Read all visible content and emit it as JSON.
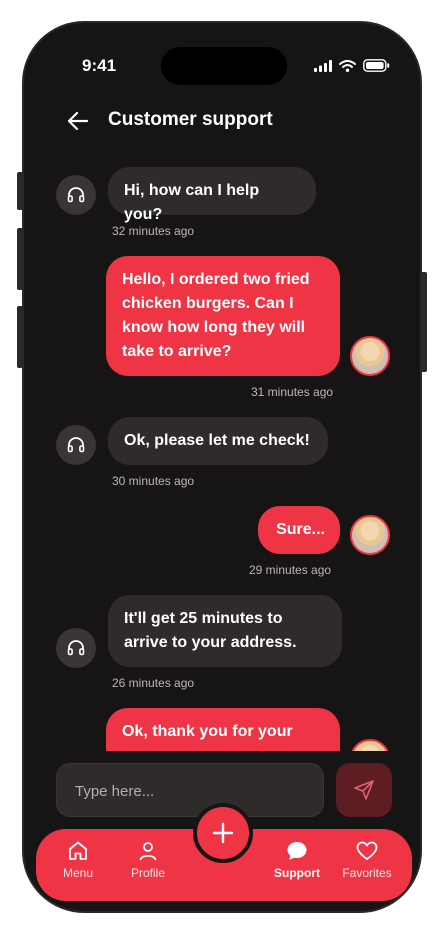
{
  "status_bar": {
    "time": "9:41"
  },
  "header": {
    "title": "Customer support"
  },
  "messages": [
    {
      "sender": "agent",
      "text": "Hi, how can I help you?",
      "time": "32 minutes ago"
    },
    {
      "sender": "user",
      "text": "Hello, I ordered two fried chicken burgers. Can I know how long they will take to arrive?",
      "time": "31 minutes ago"
    },
    {
      "sender": "agent",
      "text": "Ok, please let me check!",
      "time": "30 minutes ago"
    },
    {
      "sender": "user",
      "text": "Sure...",
      "time": "29 minutes ago"
    },
    {
      "sender": "agent",
      "text": "It'll get 25 minutes to arrive to your address.",
      "time": "26 minutes ago"
    },
    {
      "sender": "user",
      "text": "Ok, thank you for your"
    }
  ],
  "composer": {
    "placeholder": "Type here..."
  },
  "nav": {
    "items": [
      {
        "label": "Menu",
        "icon": "home-icon"
      },
      {
        "label": "Profile",
        "icon": "person-icon"
      },
      {
        "label": "Support",
        "icon": "chat-bubble-icon"
      },
      {
        "label": "Favorites",
        "icon": "heart-icon"
      }
    ],
    "active": "Support",
    "fab_icon": "plus-icon"
  },
  "colors": {
    "accent": "#ef3545",
    "background": "#161414",
    "bubble_agent": "#2f2b2b"
  }
}
